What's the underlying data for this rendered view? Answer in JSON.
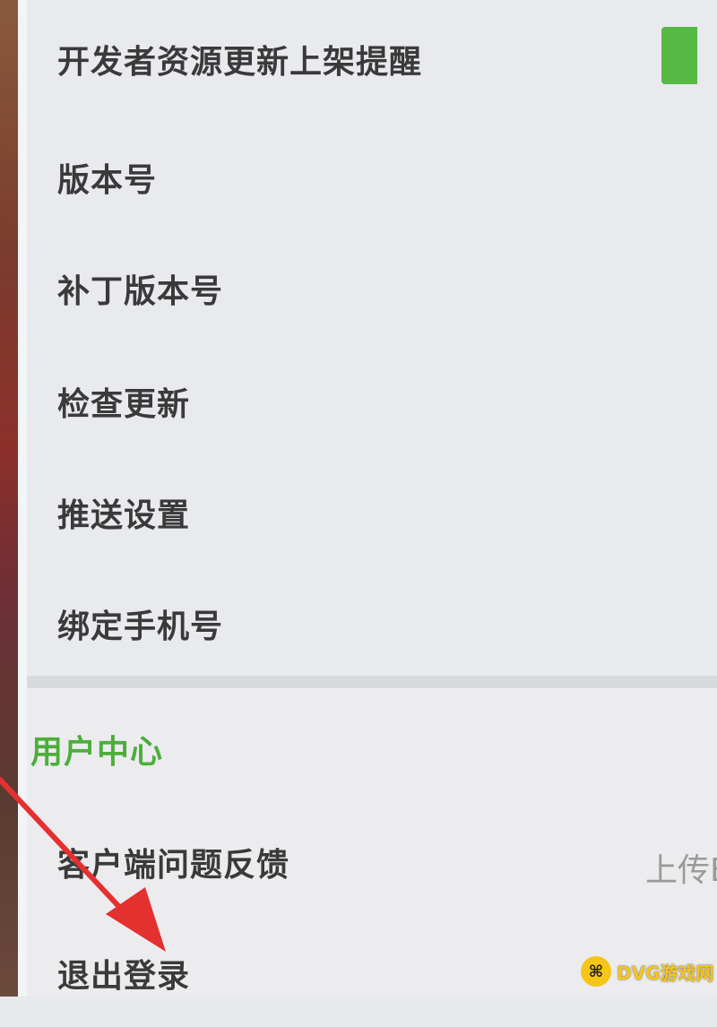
{
  "settings": {
    "items": [
      {
        "label": "开发者资源更新上架提醒"
      },
      {
        "label": "版本号"
      },
      {
        "label": "补丁版本号"
      },
      {
        "label": "检查更新"
      },
      {
        "label": "推送设置"
      },
      {
        "label": "绑定手机号"
      }
    ]
  },
  "user_center": {
    "title": "用户中心",
    "items": [
      {
        "label": "客户端问题反馈",
        "value": "上传E"
      },
      {
        "label": "退出登录"
      }
    ]
  },
  "watermark": {
    "text": "DVG游戏网",
    "icon": "gamepad-icon"
  },
  "colors": {
    "accent_green": "#4cae3a",
    "annotation_red": "#e53030"
  }
}
